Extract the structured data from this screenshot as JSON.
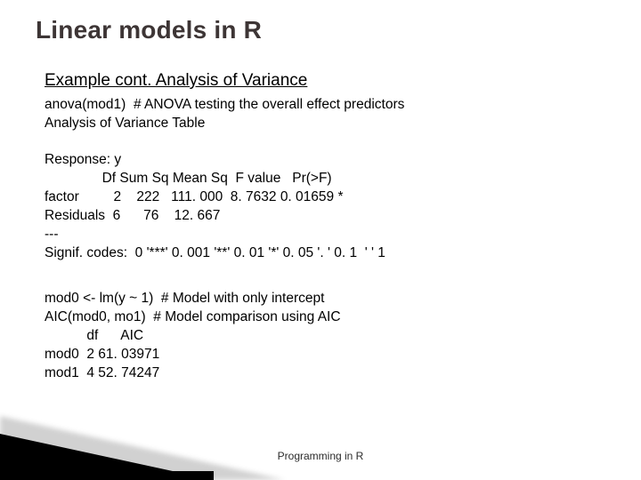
{
  "title": "Linear models in R",
  "subtitle": "Example cont. Analysis of Variance",
  "block1": "anova(mod1)  # ANOVA testing the overall effect predictors\nAnalysis of Variance Table",
  "block2": "Response: y\n               Df Sum Sq Mean Sq  F value   Pr(>F)\nfactor         2    222   111. 000  8. 7632 0. 01659 *\nResiduals  6      76    12. 667\n---\nSignif. codes:  0 '***' 0. 001 '**' 0. 01 '*' 0. 05 '. ' 0. 1  ' ' 1",
  "block3": "mod0 <- lm(y ~ 1)  # Model with only intercept\nAIC(mod0, mo1)  # Model comparison using AIC\n           df      AIC\nmod0  2 61. 03971\nmod1  4 52. 74247",
  "footer": "Programming in R"
}
